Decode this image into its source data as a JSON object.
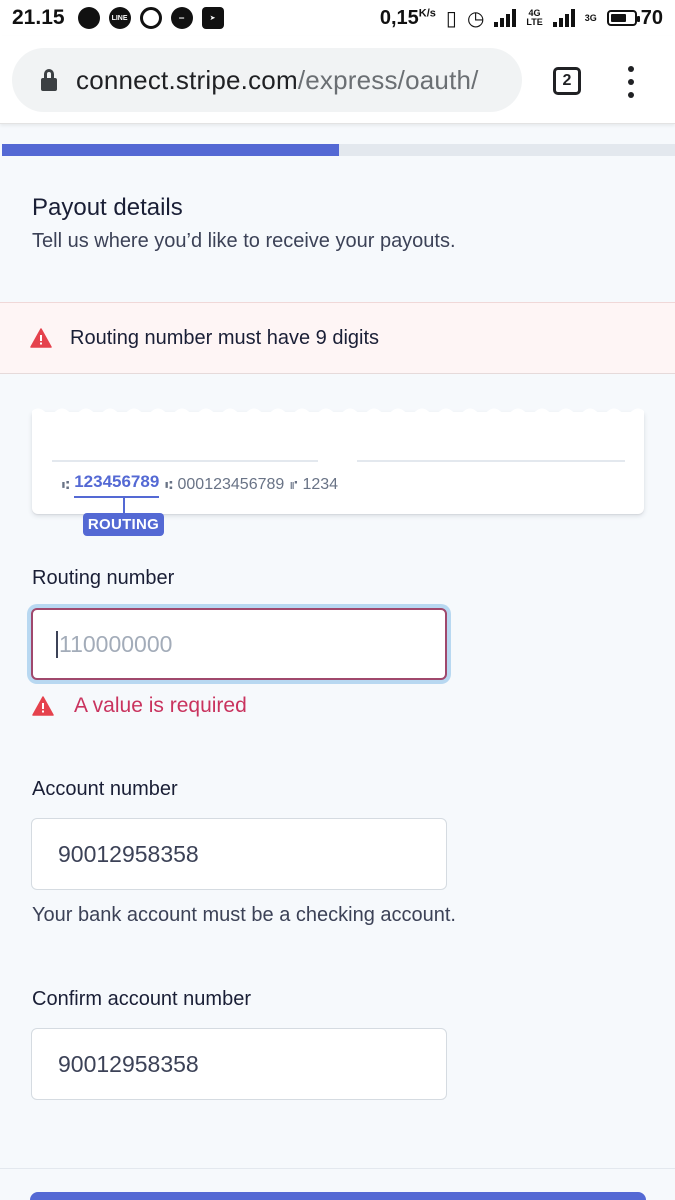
{
  "status_bar": {
    "time": "21.15",
    "app_icons": [
      "chat-icon",
      "line-icon",
      "hotspot-icon",
      "message-icon",
      "telegram-icon"
    ],
    "net_speed": "0,15",
    "net_unit": "K/s",
    "network_4g": "4G",
    "network_lte": "LTE",
    "network_3g": "3G",
    "battery": "70"
  },
  "browser": {
    "url_domain": "connect.stripe.com",
    "url_path": "/express/oauth/",
    "tab_count": "2"
  },
  "progress": {
    "fraction": 0.5,
    "accent": "#5469d4"
  },
  "header": {
    "title": "Payout details",
    "subtitle": "Tell us where you’d like to receive your payouts."
  },
  "error_banner": {
    "message": "Routing number must have 9 digits",
    "color": "#e5424d"
  },
  "check": {
    "routing_number": "123456789",
    "account_number": "000123456789",
    "check_number": "1234",
    "badge": "ROUTING"
  },
  "form": {
    "routing": {
      "label": "Routing number",
      "value": "",
      "placeholder": "110000000",
      "error": "A value is required"
    },
    "account": {
      "label": "Account number",
      "value": "90012958358",
      "helper": "Your bank account must be a checking account."
    },
    "confirm": {
      "label": "Confirm account number",
      "value": "90012958358"
    }
  }
}
